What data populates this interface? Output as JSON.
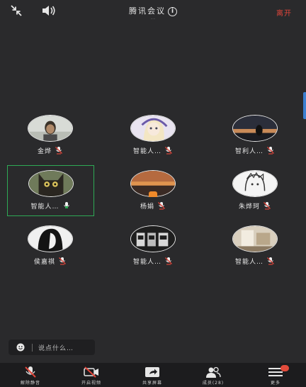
{
  "topbar": {
    "title": "腾讯会议",
    "subtitle": "·····",
    "leave_label": "离开"
  },
  "participants": [
    {
      "name": "金烨",
      "muted": true
    },
    {
      "name": "智能人…",
      "muted": true
    },
    {
      "name": "智利人…",
      "muted": true
    },
    {
      "name": "智能人…",
      "muted": false,
      "active": true
    },
    {
      "name": "杨娟",
      "muted": true,
      "badge": true
    },
    {
      "name": "朱烨珂",
      "muted": true
    },
    {
      "name": "侯嘉祺",
      "muted": true
    },
    {
      "name": "智能人…",
      "muted": true
    },
    {
      "name": "智能人…",
      "muted": true
    }
  ],
  "chat": {
    "placeholder": "说点什么…"
  },
  "pager": {
    "count": 4,
    "current": 0
  },
  "toolbar": {
    "items": [
      {
        "label": "解除静音",
        "icon": "mic-muted-icon"
      },
      {
        "label": "开启视频",
        "icon": "video-off-icon"
      },
      {
        "label": "共享屏幕",
        "icon": "share-screen-icon"
      },
      {
        "label": "成员(28)",
        "icon": "members-icon"
      },
      {
        "label": "更多",
        "icon": "more-icon"
      }
    ]
  },
  "colors": {
    "accent_active": "#2eaa55",
    "mute_red": "#e0453a",
    "badge_red": "#e24b3b"
  }
}
